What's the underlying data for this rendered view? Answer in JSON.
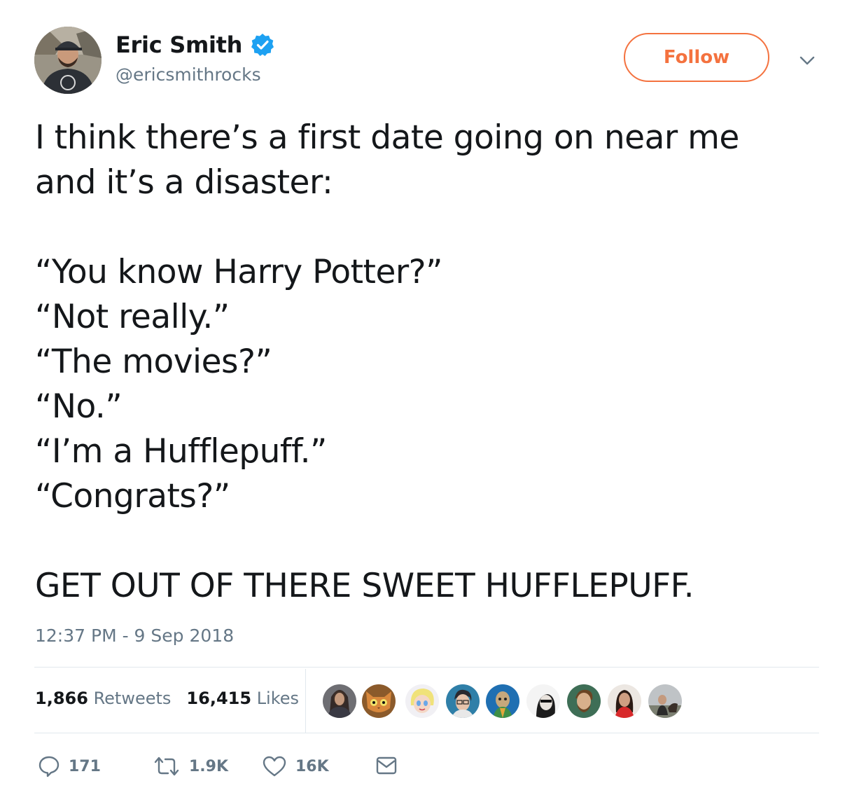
{
  "author": {
    "name": "Eric Smith",
    "handle": "@ericsmithrocks",
    "verified": true
  },
  "follow_label": "Follow",
  "accent_color": "#f4723f",
  "verified_color": "#1da1f2",
  "text_lines": [
    "I think there’s a first date going on near me",
    "and it’s a disaster:",
    "",
    "“You know Harry Potter?”",
    "“Not really.”",
    "“The movies?”",
    "“No.”",
    "“I’m a Hufflepuff.”",
    "“Congrats?”",
    "",
    "GET OUT OF THERE SWEET HUFFLEPUFF."
  ],
  "timestamp": "12:37 PM - 9 Sep 2018",
  "stats": {
    "retweets_count": "1,866",
    "retweets_label": "Retweets",
    "likes_count": "16,415",
    "likes_label": "Likes"
  },
  "likers_count_shown": 9,
  "actions": {
    "reply_count": "171",
    "retweet_count": "1.9K",
    "like_count": "16K"
  },
  "icons": {
    "verified": "verified-badge-icon",
    "chevron": "chevron-down-icon",
    "reply": "reply-icon",
    "retweet": "retweet-icon",
    "like": "heart-icon",
    "dm": "envelope-icon"
  }
}
